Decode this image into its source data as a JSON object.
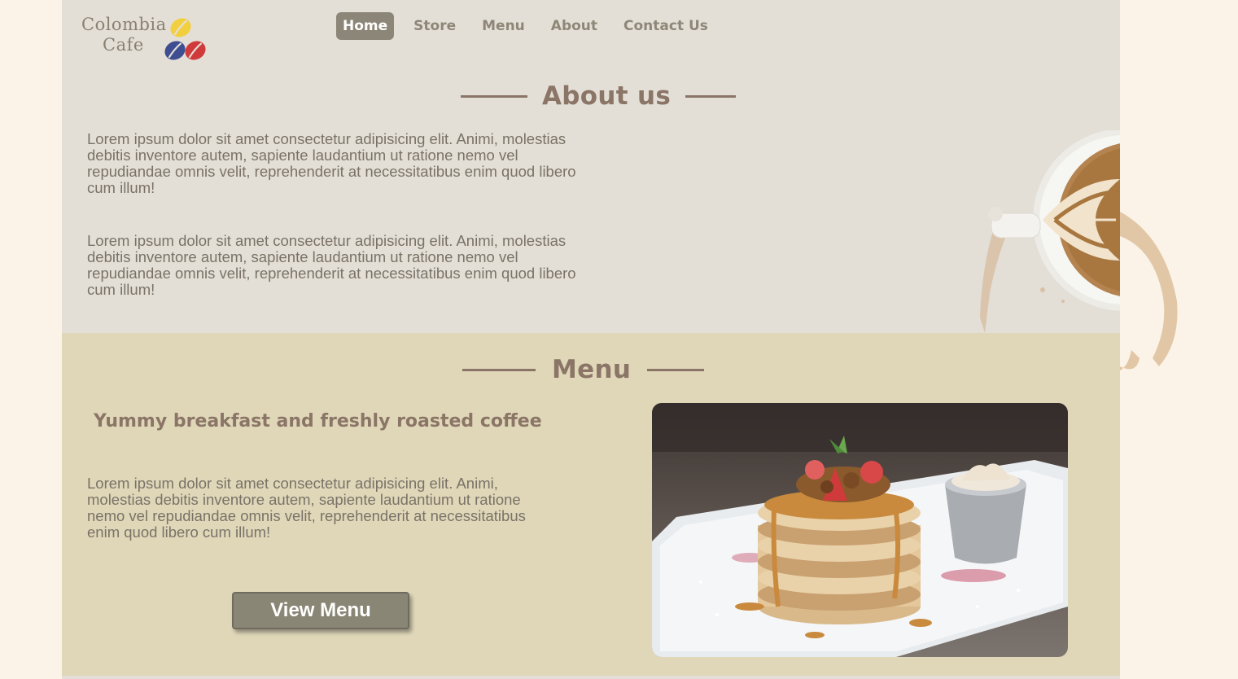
{
  "brand": {
    "line1": "Colombia",
    "line2": "Cafe",
    "colors": [
      "#f2cf3f",
      "#3f4d91",
      "#d13a3a"
    ]
  },
  "nav": {
    "items": [
      {
        "label": "Home",
        "active": true
      },
      {
        "label": "Store",
        "active": false
      },
      {
        "label": "Menu",
        "active": false
      },
      {
        "label": "About",
        "active": false
      },
      {
        "label": "Contact Us",
        "active": false
      }
    ]
  },
  "about": {
    "title": "About us",
    "paragraph1": "Lorem ipsum dolor sit amet consectetur adipisicing elit. Animi, molestias debitis inventore autem, sapiente laudantium ut ratione nemo vel repudiandae omnis velit, reprehenderit at necessitatibus enim quod libero cum illum!",
    "paragraph2": "Lorem ipsum dolor sit amet consectetur adipisicing elit. Animi, molestias debitis inventore autem, sapiente laudantium ut ratione nemo vel repudiandae omnis velit, reprehenderit at necessitatibus enim quod libero cum illum!",
    "image": "latte-art-coffee-cup"
  },
  "menu": {
    "title": "Menu",
    "subheading": "Yummy breakfast and freshly roasted coffee",
    "paragraph": "Lorem ipsum dolor sit amet consectetur adipisicing elit. Animi, molestias debitis inventore autem, sapiente laudantium ut ratione nemo vel repudiandae omnis velit, reprehenderit at necessitatibus enim quod libero cum illum!",
    "button_label": "View Menu",
    "image": "pancakes-with-strawberries-and-caramel"
  },
  "theme": {
    "page_bg": "#fbf3e7",
    "about_bg": "#e3dfd7",
    "menu_bg": "#e0d7b9",
    "accent": "#8a7566",
    "button_bg": "#8a8675"
  }
}
